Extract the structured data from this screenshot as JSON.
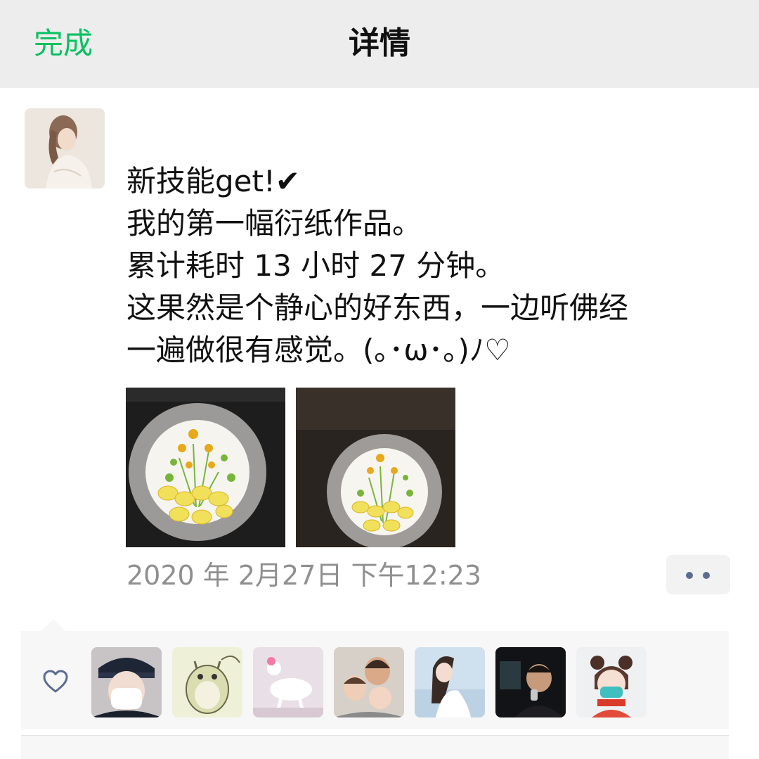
{
  "navbar": {
    "done_label": "完成",
    "title": "详情"
  },
  "post": {
    "lines": [
      "新技能get!✔",
      "我的第一幅衍纸作品。",
      "累计耗时 13 小时 27 分钟。",
      "这果然是个静心的好东西，一边听佛经",
      "一遍做很有感觉。(｡･ω･｡)ﾉ♡"
    ],
    "timestamp": "2020 年 2月27日 下午12:23"
  },
  "colors": {
    "accent": "#07c160",
    "link_blue": "#5a6d90",
    "meta_gray": "#8f8f8f"
  },
  "icons": {
    "like": "heart-outline-icon",
    "more": "more-dots-icon"
  }
}
